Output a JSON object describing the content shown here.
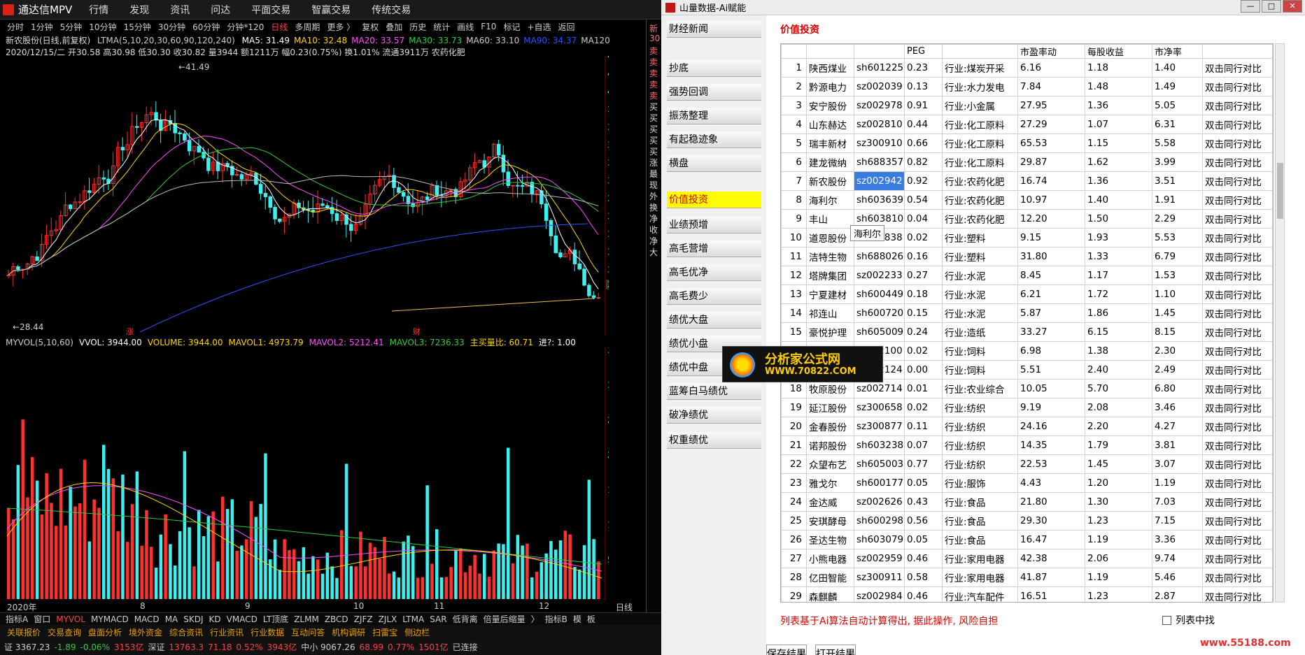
{
  "tdx": {
    "app_title": "通达信MPV",
    "menu": [
      "行情",
      "发现",
      "资讯",
      "问达",
      "平面交易",
      "智赢交易",
      "传统交易"
    ],
    "periods": [
      "分时",
      "1分钟",
      "5分钟",
      "10分钟",
      "15分钟",
      "30分钟",
      "60分钟",
      "分钟*120",
      "日线",
      "多周期",
      "更多 〉",
      "复权",
      "叠加",
      "历史",
      "统计",
      "画线",
      "F10",
      "标记",
      "+自选",
      "返回"
    ],
    "stock_line": "新农股份(日线,前复权)",
    "ma_label": "LTMA(5,10,20,30,60,90,120,240)",
    "ma_values": [
      "MA5: 31.49",
      "MA10: 32.48",
      "MA20: 33.57",
      "MA30: 33.73",
      "MA60: 33.10",
      "MA90: 34.37",
      "MA120"
    ],
    "bar_info": "2020/12/15/二 开30.58 高30.98 低30.30 收30.82 量3944 额1211万 幅0.23(0.75%) 换1.01% 流通3911万 农药化肥",
    "price_axis": [
      "42.00",
      "41.00",
      "40.00",
      "39.00",
      "38.00",
      "37.00",
      "36.00",
      "35.00",
      "34.00",
      "33.00",
      "32.00",
      "31.00",
      "30.00"
    ],
    "high_label": "41.49",
    "low_label": "28.44",
    "last_price": "30.19",
    "vol_axis": [
      "35000",
      "30000",
      "25000",
      "20000",
      "15000",
      "10000",
      "5000"
    ],
    "vol_info": [
      "MYVOL(5,10,60)",
      "VVOL: 3944.00",
      "VOLUME: 3944.00",
      "MAVOL1: 4973.79",
      "MAVOL2: 5212.41",
      "MAVOL3: 7236.33",
      "主买量比: 60.71",
      "进?: 1.00"
    ],
    "months": [
      "2020年",
      "8",
      "9",
      "10",
      "11",
      "12",
      "日线"
    ],
    "indicators": [
      "指标A",
      "窗口",
      "MYVOL",
      "MYMACD",
      "MACD",
      "MA",
      "SKDJ",
      "KD",
      "VMACD",
      "LT顶底",
      "ZLMM",
      "ZBCD",
      "ZJFZ",
      "ZJLX",
      "LTMA",
      "SAR",
      "低背离",
      "倍量后缩量",
      "〉",
      "指标B",
      "模",
      "板"
    ],
    "tabs": [
      "关联报价",
      "交易查询",
      "盘面分析",
      "境外资金",
      "综合资讯",
      "行业资讯",
      "行业数据",
      "互动问答",
      "机构调研",
      "扫雷宝",
      "侧边栏"
    ],
    "status": [
      "证 3367.23",
      "-1.89",
      "-0.06%",
      "3153亿",
      "深证",
      "13763.3",
      "71.18",
      "0.52%",
      "3943亿",
      "中小 9067.26",
      "68.99",
      "0.77%",
      "1501亿",
      "已连接"
    ],
    "side": [
      "新",
      "30",
      "卖",
      "卖",
      "卖",
      "卖",
      "卖",
      "买",
      "买",
      "买",
      "买",
      "买",
      "涨",
      "最",
      "现",
      "外",
      "换",
      "净",
      "收",
      "净",
      "大"
    ],
    "small_nums": [
      "14",
      "14",
      "14",
      "14",
      "14",
      "14",
      "14"
    ],
    "markers": [
      "涨",
      "财"
    ]
  },
  "sx": {
    "title": "山量数据-Ai赋能",
    "menu": [
      "财经新闻",
      "抄底",
      "强势回调",
      "振荡整理",
      "有起稳迹象",
      "横盘",
      "价值投资",
      "业绩预增",
      "高毛营增",
      "高毛优净",
      "高毛费少",
      "绩优大盘",
      "绩优小盘",
      "绩优中盘",
      "蓝筹白马绩优",
      "破净绩优",
      "权重绩优"
    ],
    "section": "价值投资",
    "cols": [
      "",
      "",
      "",
      "PEG",
      "",
      "市盈率动",
      "每股收益",
      "市净率",
      ""
    ],
    "rows": [
      [
        "1",
        "陕西煤业",
        "sh601225",
        "0.23",
        "行业:煤炭开采",
        "6.16",
        "1.18",
        "1.40",
        "双击同行对比"
      ],
      [
        "2",
        "黔源电力",
        "sz002039",
        "0.13",
        "行业:水力发电",
        "7.84",
        "1.48",
        "1.49",
        "双击同行对比"
      ],
      [
        "3",
        "安宁股份",
        "sz002978",
        "0.91",
        "行业:小金属",
        "27.95",
        "1.36",
        "5.05",
        "双击同行对比"
      ],
      [
        "4",
        "山东赫达",
        "sz002810",
        "0.44",
        "行业:化工原料",
        "27.29",
        "1.07",
        "6.31",
        "双击同行对比"
      ],
      [
        "5",
        "瑞丰新材",
        "sz300910",
        "0.66",
        "行业:化工原料",
        "65.53",
        "1.15",
        "5.58",
        "双击同行对比"
      ],
      [
        "6",
        "建龙微纳",
        "sh688357",
        "0.82",
        "行业:化工原料",
        "29.87",
        "1.62",
        "3.99",
        "双击同行对比"
      ],
      [
        "7",
        "新农股份",
        "sz002942",
        "0.92",
        "行业:农药化肥",
        "16.74",
        "1.36",
        "3.51",
        "双击同行对比"
      ],
      [
        "8",
        "海利尔",
        "sh603639",
        "0.54",
        "行业:农药化肥",
        "10.97",
        "1.40",
        "1.91",
        "双击同行对比"
      ],
      [
        "9",
        "丰山",
        "sh603810",
        "0.04",
        "行业:农药化肥",
        "12.20",
        "1.50",
        "2.29",
        "双击同行对比"
      ],
      [
        "10",
        "道恩股份",
        "sz002838",
        "0.02",
        "行业:塑料",
        "9.15",
        "1.93",
        "5.53",
        "双击同行对比"
      ],
      [
        "11",
        "洁特生物",
        "sh688026",
        "0.16",
        "行业:塑料",
        "31.80",
        "1.33",
        "6.79",
        "双击同行对比"
      ],
      [
        "12",
        "塔牌集团",
        "sz002233",
        "0.27",
        "行业:水泥",
        "8.45",
        "1.17",
        "1.53",
        "双击同行对比"
      ],
      [
        "13",
        "宁夏建材",
        "sh600449",
        "0.18",
        "行业:水泥",
        "6.21",
        "1.72",
        "1.10",
        "双击同行对比"
      ],
      [
        "14",
        "祁连山",
        "sh600720",
        "0.15",
        "行业:水泥",
        "5.87",
        "1.86",
        "1.45",
        "双击同行对比"
      ],
      [
        "15",
        "豪悦护理",
        "sh605009",
        "0.24",
        "行业:造纸",
        "33.27",
        "6.15",
        "8.15",
        "双击同行对比"
      ],
      [
        "16",
        "",
        "sz002100",
        "0.02",
        "行业:饲料",
        "6.98",
        "1.38",
        "2.30",
        "双击同行对比"
      ],
      [
        "17",
        "",
        "sz002124",
        "0.00",
        "行业:饲料",
        "5.51",
        "2.40",
        "2.49",
        "双击同行对比"
      ],
      [
        "18",
        "牧原股份",
        "sz002714",
        "0.01",
        "行业:农业综合",
        "10.05",
        "5.70",
        "6.80",
        "双击同行对比"
      ],
      [
        "19",
        "延江股份",
        "sz300658",
        "0.02",
        "行业:纺织",
        "9.19",
        "2.08",
        "3.46",
        "双击同行对比"
      ],
      [
        "20",
        "金春股份",
        "sz300877",
        "0.11",
        "行业:纺织",
        "24.16",
        "2.20",
        "4.27",
        "双击同行对比"
      ],
      [
        "21",
        "诺邦股份",
        "sh603238",
        "0.07",
        "行业:纺织",
        "14.35",
        "1.79",
        "3.81",
        "双击同行对比"
      ],
      [
        "22",
        "众望布艺",
        "sh605003",
        "0.77",
        "行业:纺织",
        "22.53",
        "1.45",
        "3.07",
        "双击同行对比"
      ],
      [
        "23",
        "雅戈尔",
        "sh600177",
        "0.05",
        "行业:服饰",
        "4.43",
        "1.20",
        "1.19",
        "双击同行对比"
      ],
      [
        "24",
        "金达威",
        "sz002626",
        "0.43",
        "行业:食品",
        "21.80",
        "1.30",
        "7.03",
        "双击同行对比"
      ],
      [
        "25",
        "安琪酵母",
        "sh600298",
        "0.56",
        "行业:食品",
        "29.30",
        "1.23",
        "7.15",
        "双击同行对比"
      ],
      [
        "26",
        "圣达生物",
        "sh603079",
        "0.05",
        "行业:食品",
        "16.47",
        "1.19",
        "3.36",
        "双击同行对比"
      ],
      [
        "27",
        "小熊电器",
        "sz002959",
        "0.46",
        "行业:家用电器",
        "42.38",
        "2.06",
        "9.74",
        "双击同行对比"
      ],
      [
        "28",
        "亿田智能",
        "sz300911",
        "0.58",
        "行业:家用电器",
        "41.87",
        "1.19",
        "5.46",
        "双击同行对比"
      ],
      [
        "29",
        "森麒麟",
        "sz002984",
        "0.46",
        "行业:汽车配件",
        "16.51",
        "1.23",
        "2.87",
        "双击同行对比"
      ]
    ],
    "tooltip": "海利尔",
    "note": "列表基于Ai算法自动计算得出, 据此操作, 风险自担",
    "save_btn": "保存结果",
    "open_btn": "打开结果",
    "filter_label": "列表中找",
    "watermark1": "分析家公式网",
    "watermark2": "WWW.70822.COM",
    "watermark3": "www.55188.com"
  }
}
